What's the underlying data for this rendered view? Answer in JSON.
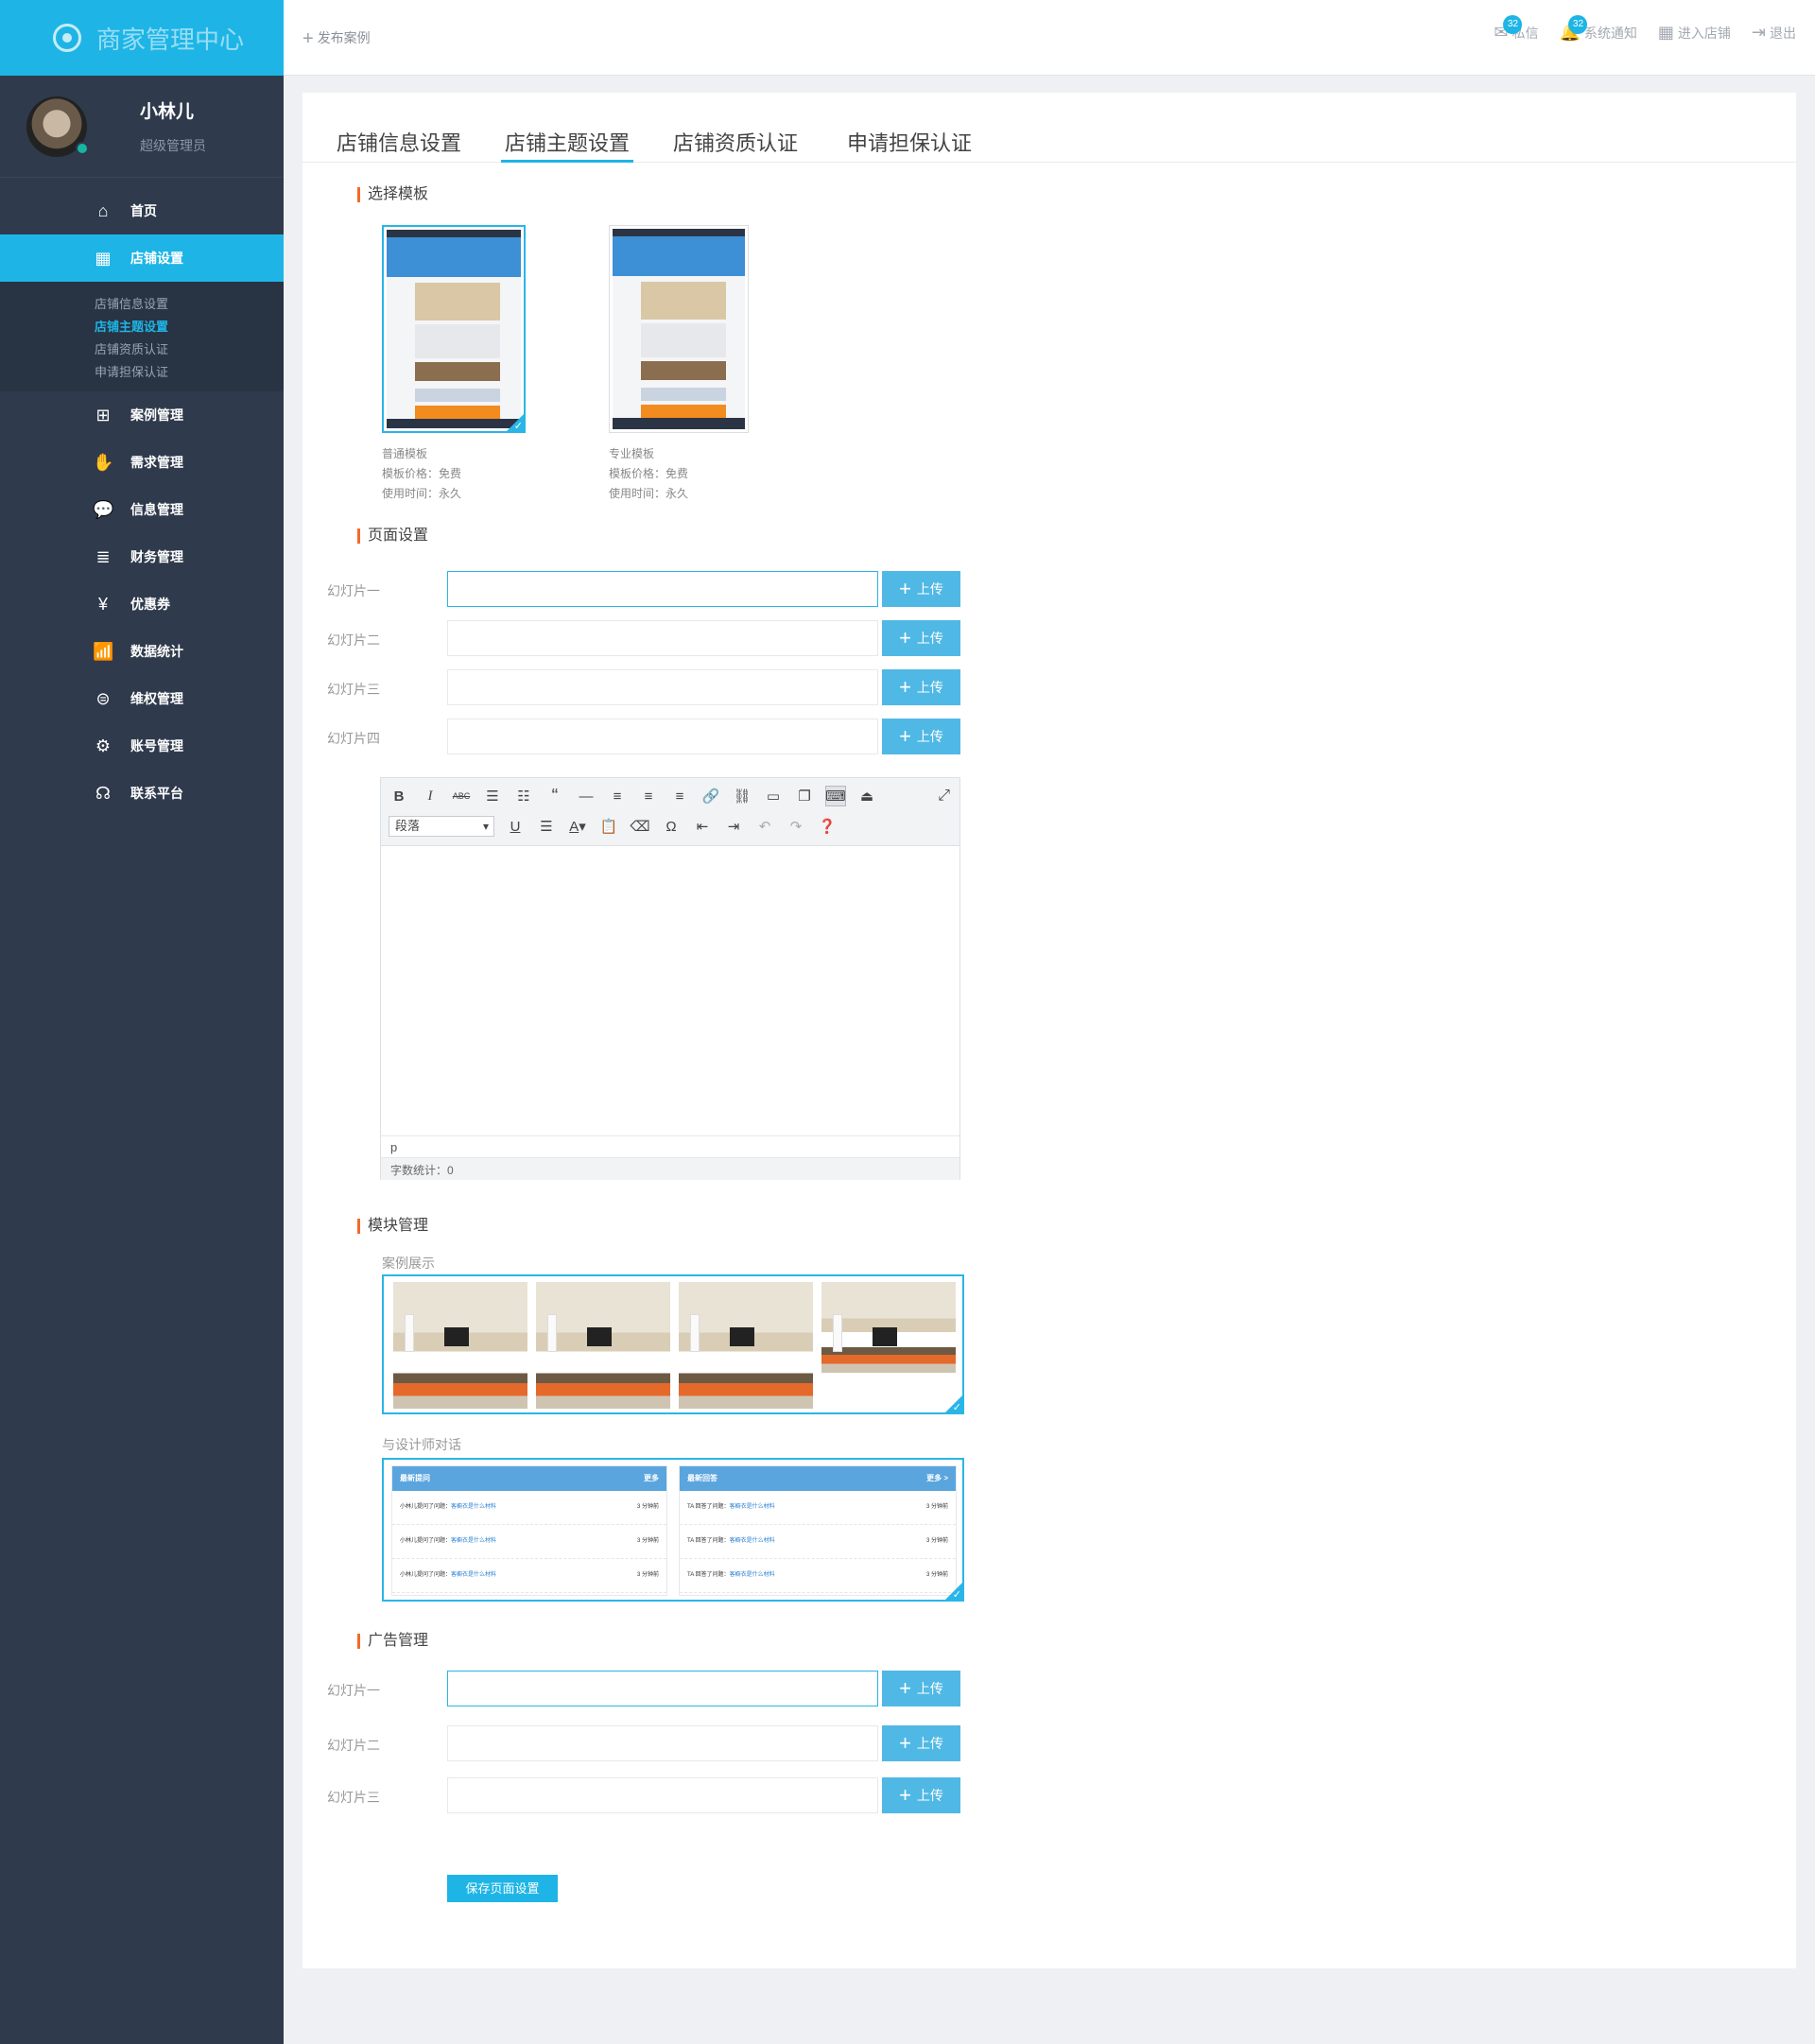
{
  "app": {
    "title": "商家管理中心"
  },
  "user": {
    "name": "小林儿",
    "role": "超级管理员"
  },
  "sidebar": {
    "items": [
      {
        "label": "首页",
        "icon": "home-icon",
        "glyph": "⌂",
        "active": false
      },
      {
        "label": "店铺设置",
        "icon": "store-icon",
        "glyph": "▦",
        "active": true
      },
      {
        "label": "案例管理",
        "icon": "grid-icon",
        "glyph": "⊞",
        "active": false
      },
      {
        "label": "需求管理",
        "icon": "hand-icon",
        "glyph": "✋",
        "active": false
      },
      {
        "label": "信息管理",
        "icon": "chat-icon",
        "glyph": "💬",
        "active": false
      },
      {
        "label": "财务管理",
        "icon": "coins-icon",
        "glyph": "≣",
        "active": false
      },
      {
        "label": "优惠券",
        "icon": "coupon-icon",
        "glyph": "¥",
        "active": false
      },
      {
        "label": "数据统计",
        "icon": "chart-icon",
        "glyph": "📶",
        "active": false
      },
      {
        "label": "维权管理",
        "icon": "yen-circle-icon",
        "glyph": "⊜",
        "active": false
      },
      {
        "label": "账号管理",
        "icon": "gear-icon",
        "glyph": "⚙",
        "active": false
      },
      {
        "label": "联系平台",
        "icon": "headset-icon",
        "glyph": "☊",
        "active": false
      }
    ],
    "submenu": [
      "店铺信息设置",
      "店铺主题设置",
      "店铺资质认证",
      "申请担保认证"
    ],
    "submenu_current": 1
  },
  "topbar": {
    "publish": "发布案例",
    "messages": {
      "label": "私信",
      "count": "32"
    },
    "notices": {
      "label": "系统通知",
      "count": "32"
    },
    "enter_store": "进入店铺",
    "logout": "退出"
  },
  "tabs": [
    "店铺信息设置",
    "店铺主题设置",
    "店铺资质认证",
    "申请担保认证"
  ],
  "active_tab": 1,
  "templates": {
    "title": "选择模板",
    "items": [
      {
        "name": "普通模板",
        "price": "模板价格：免费",
        "duration": "使用时间：永久",
        "selected": true
      },
      {
        "name": "专业模板",
        "price": "模板价格：免费",
        "duration": "使用时间：永久",
        "selected": false
      }
    ]
  },
  "page_settings": {
    "title": "页面设置",
    "rows": [
      {
        "label": "幻灯片一",
        "value": ""
      },
      {
        "label": "幻灯片二",
        "value": ""
      },
      {
        "label": "幻灯片三",
        "value": ""
      },
      {
        "label": "幻灯片四",
        "value": ""
      }
    ],
    "upload_label": "上传"
  },
  "editor": {
    "format_select": "段落",
    "path": "p",
    "word_count": "字数统计：0"
  },
  "modules": {
    "title": "模块管理",
    "case_label": "案例展示",
    "chat_label": "与设计师对话",
    "chat": {
      "questions_title": "最新提问",
      "questions_more": "更多",
      "answers_title": "最新回答",
      "answers_more": "更多 >",
      "question_lines": [
        {
          "prefix": "小林儿提问了问题：",
          "link": "客橱衣是什么材料",
          "time": "3 分钟前"
        },
        {
          "prefix": "小林儿提问了问题：",
          "link": "客橱衣是什么材料",
          "time": "3 分钟前"
        },
        {
          "prefix": "小林儿提问了问题：",
          "link": "客橱衣是什么材料",
          "time": "3 分钟前"
        }
      ],
      "answer_lines": [
        {
          "prefix": "TA 回答了问题：",
          "link": "客橱衣是什么材料",
          "time": "3 分钟前"
        },
        {
          "prefix": "TA 回答了问题：",
          "link": "客橱衣是什么材料",
          "time": "3 分钟前"
        },
        {
          "prefix": "TA 回答了问题：",
          "link": "客橱衣是什么材料",
          "time": "3 分钟前"
        }
      ]
    }
  },
  "ads": {
    "title": "广告管理",
    "rows": [
      {
        "label": "幻灯片一",
        "value": ""
      },
      {
        "label": "幻灯片二",
        "value": ""
      },
      {
        "label": "幻灯片三",
        "value": ""
      }
    ],
    "upload_label": "上传"
  },
  "save_label": "保存页面设置",
  "colors": {
    "accent": "#1eb5e6",
    "sidebar": "#2f3a4c",
    "upload": "#50b8e5",
    "marker": "#f26a2a"
  }
}
